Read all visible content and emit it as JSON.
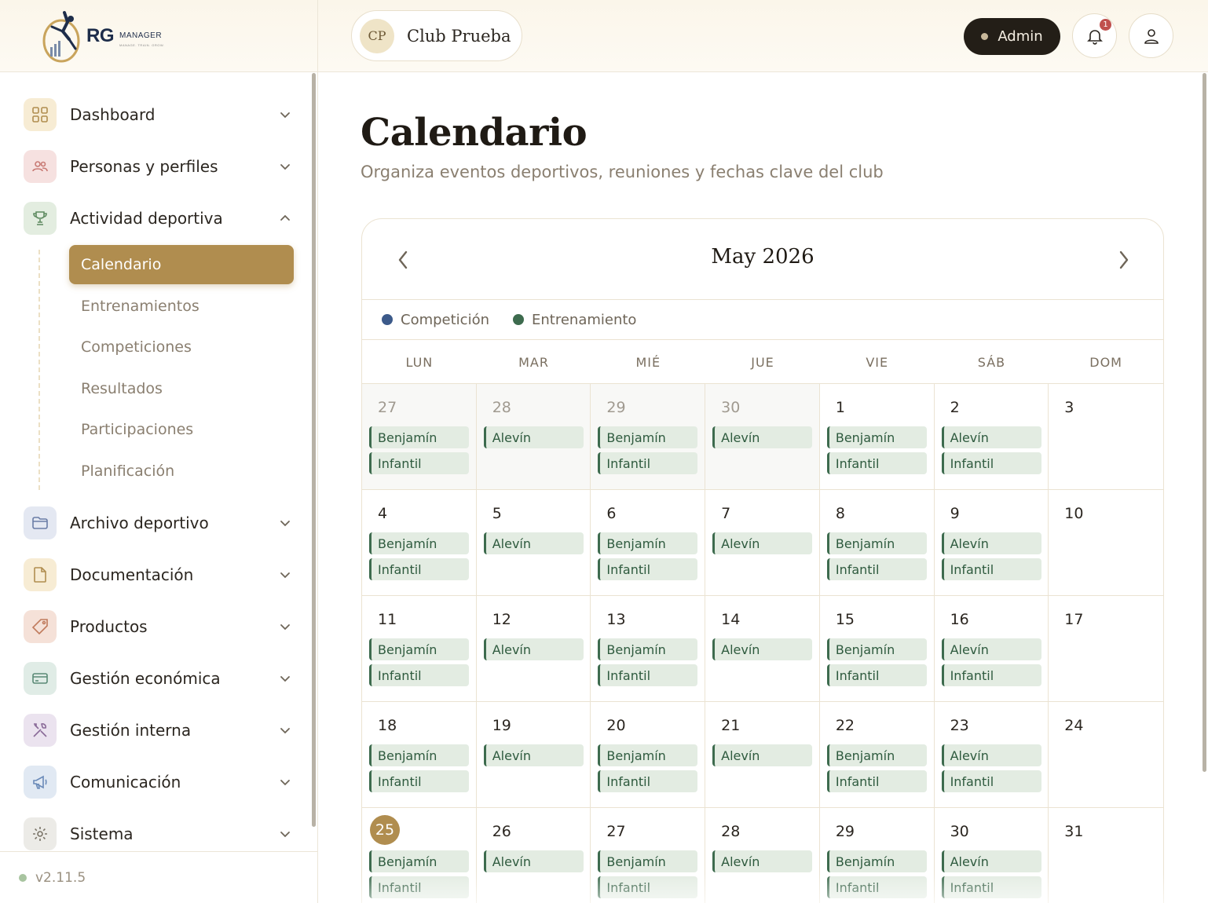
{
  "brand": {
    "name": "RG",
    "suffix": "MANAGER",
    "tagline": "MANAGE. TRAIN. GROW."
  },
  "header": {
    "club_initials": "CP",
    "club_name": "Club Prueba",
    "role_label": "Admin",
    "notification_count": "1"
  },
  "sidebar": {
    "items": [
      {
        "label": "Dashboard",
        "icon": "grid-icon",
        "color": "#f7ecd4",
        "expanded": false
      },
      {
        "label": "Personas y perfiles",
        "icon": "users-icon",
        "color": "#f6e1e0",
        "expanded": false
      },
      {
        "label": "Actividad deportiva",
        "icon": "trophy-icon",
        "color": "#e3ede0",
        "expanded": true
      },
      {
        "label": "Archivo deportivo",
        "icon": "folder-icon",
        "color": "#e4e8f2",
        "expanded": false
      },
      {
        "label": "Documentación",
        "icon": "document-icon",
        "color": "#f7ecd4",
        "expanded": false
      },
      {
        "label": "Productos",
        "icon": "tag-icon",
        "color": "#f5e1d8",
        "expanded": false
      },
      {
        "label": "Gestión económica",
        "icon": "credit-card-icon",
        "color": "#e0ece6",
        "expanded": false
      },
      {
        "label": "Gestión interna",
        "icon": "tools-icon",
        "color": "#ebe3ef",
        "expanded": false
      },
      {
        "label": "Comunicación",
        "icon": "megaphone-icon",
        "color": "#e1e9f3",
        "expanded": false
      },
      {
        "label": "Sistema",
        "icon": "gear-icon",
        "color": "#ecebe7",
        "expanded": false
      }
    ],
    "subitems": [
      "Calendario",
      "Entrenamientos",
      "Competiciones",
      "Resultados",
      "Participaciones",
      "Planificación"
    ],
    "active_subitem": "Calendario",
    "version": "v2.11.5"
  },
  "page": {
    "title": "Calendario",
    "subtitle": "Organiza eventos deportivos, reuniones y fechas clave del club"
  },
  "calendar": {
    "month_label": "May 2026",
    "legend": [
      {
        "label": "Competición",
        "color": "#3c5a8a"
      },
      {
        "label": "Entrenamiento",
        "color": "#3d6b4e"
      }
    ],
    "weekdays": [
      "LUN",
      "MAR",
      "MIÉ",
      "JUE",
      "VIE",
      "SÁB",
      "DOM"
    ],
    "event_color": "#3d6b4e",
    "today": "25",
    "days": [
      {
        "num": "27",
        "outside": true,
        "events": [
          "Benjamín",
          "Infantil"
        ]
      },
      {
        "num": "28",
        "outside": true,
        "events": [
          "Alevín"
        ]
      },
      {
        "num": "29",
        "outside": true,
        "events": [
          "Benjamín",
          "Infantil"
        ]
      },
      {
        "num": "30",
        "outside": true,
        "events": [
          "Alevín"
        ]
      },
      {
        "num": "1",
        "outside": false,
        "events": [
          "Benjamín",
          "Infantil"
        ]
      },
      {
        "num": "2",
        "outside": false,
        "events": [
          "Alevín",
          "Infantil"
        ]
      },
      {
        "num": "3",
        "outside": false,
        "events": []
      },
      {
        "num": "4",
        "outside": false,
        "events": [
          "Benjamín",
          "Infantil"
        ]
      },
      {
        "num": "5",
        "outside": false,
        "events": [
          "Alevín"
        ]
      },
      {
        "num": "6",
        "outside": false,
        "events": [
          "Benjamín",
          "Infantil"
        ]
      },
      {
        "num": "7",
        "outside": false,
        "events": [
          "Alevín"
        ]
      },
      {
        "num": "8",
        "outside": false,
        "events": [
          "Benjamín",
          "Infantil"
        ]
      },
      {
        "num": "9",
        "outside": false,
        "events": [
          "Alevín",
          "Infantil"
        ]
      },
      {
        "num": "10",
        "outside": false,
        "events": []
      },
      {
        "num": "11",
        "outside": false,
        "events": [
          "Benjamín",
          "Infantil"
        ]
      },
      {
        "num": "12",
        "outside": false,
        "events": [
          "Alevín"
        ]
      },
      {
        "num": "13",
        "outside": false,
        "events": [
          "Benjamín",
          "Infantil"
        ]
      },
      {
        "num": "14",
        "outside": false,
        "events": [
          "Alevín"
        ]
      },
      {
        "num": "15",
        "outside": false,
        "events": [
          "Benjamín",
          "Infantil"
        ]
      },
      {
        "num": "16",
        "outside": false,
        "events": [
          "Alevín",
          "Infantil"
        ]
      },
      {
        "num": "17",
        "outside": false,
        "events": []
      },
      {
        "num": "18",
        "outside": false,
        "events": [
          "Benjamín",
          "Infantil"
        ]
      },
      {
        "num": "19",
        "outside": false,
        "events": [
          "Alevín"
        ]
      },
      {
        "num": "20",
        "outside": false,
        "events": [
          "Benjamín",
          "Infantil"
        ]
      },
      {
        "num": "21",
        "outside": false,
        "events": [
          "Alevín"
        ]
      },
      {
        "num": "22",
        "outside": false,
        "events": [
          "Benjamín",
          "Infantil"
        ]
      },
      {
        "num": "23",
        "outside": false,
        "events": [
          "Alevín",
          "Infantil"
        ]
      },
      {
        "num": "24",
        "outside": false,
        "events": []
      },
      {
        "num": "25",
        "outside": false,
        "events": [
          "Benjamín",
          "Infantil"
        ]
      },
      {
        "num": "26",
        "outside": false,
        "events": [
          "Alevín"
        ]
      },
      {
        "num": "27",
        "outside": false,
        "events": [
          "Benjamín",
          "Infantil"
        ]
      },
      {
        "num": "28",
        "outside": false,
        "events": [
          "Alevín"
        ]
      },
      {
        "num": "29",
        "outside": false,
        "events": [
          "Benjamín",
          "Infantil"
        ]
      },
      {
        "num": "30",
        "outside": false,
        "events": [
          "Alevín",
          "Infantil"
        ]
      },
      {
        "num": "31",
        "outside": false,
        "events": []
      }
    ]
  }
}
